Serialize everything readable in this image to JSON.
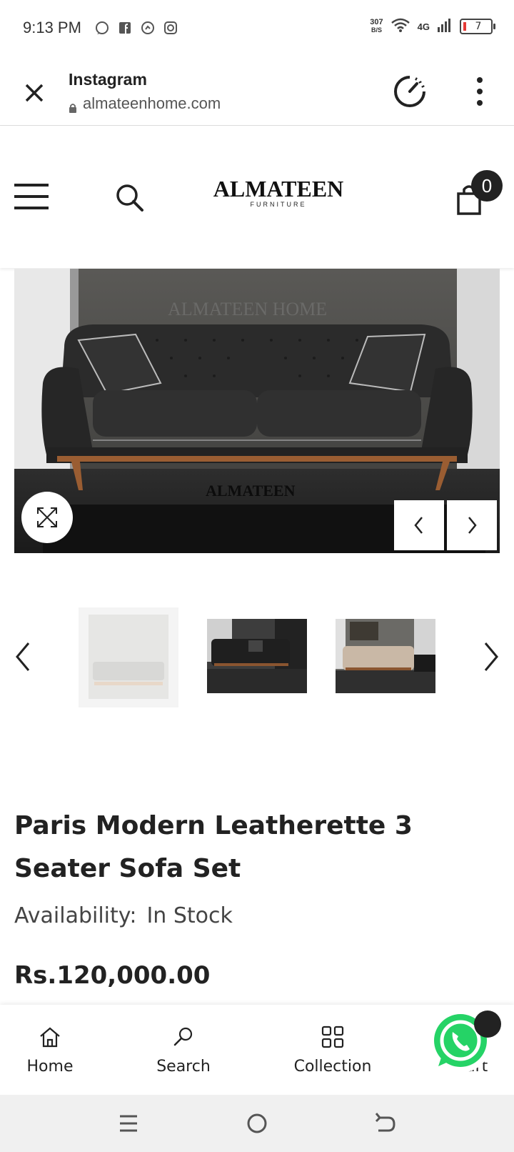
{
  "status_bar": {
    "time": "9:13 PM",
    "net_speed_value": "307",
    "net_speed_unit": "B/S",
    "network": "4G",
    "battery": "7"
  },
  "browser": {
    "title": "Instagram",
    "url": "almateenhome.com"
  },
  "site_header": {
    "logo_main": "ALMATEEN",
    "logo_sub": "FURNITURE",
    "cart_count": "0"
  },
  "main_image": {
    "watermark_top": "ALMATEEN HOME",
    "watermark_bottom": "ALMATEEN"
  },
  "product": {
    "title": "Paris Modern Leatherette 3 Seater Sofa Set",
    "availability_label": "Availability:",
    "availability_value": "In Stock",
    "price": "Rs.120,000.00"
  },
  "bottom_nav": {
    "items": [
      {
        "label": "Home",
        "icon": "home-icon"
      },
      {
        "label": "Search",
        "icon": "search-icon"
      },
      {
        "label": "Collection",
        "icon": "grid-icon"
      },
      {
        "label": "Cart",
        "icon": "cart-icon"
      }
    ]
  },
  "colors": {
    "accent_dark": "#222222",
    "whatsapp_green": "#25D366",
    "battery_low": "#e53935"
  }
}
